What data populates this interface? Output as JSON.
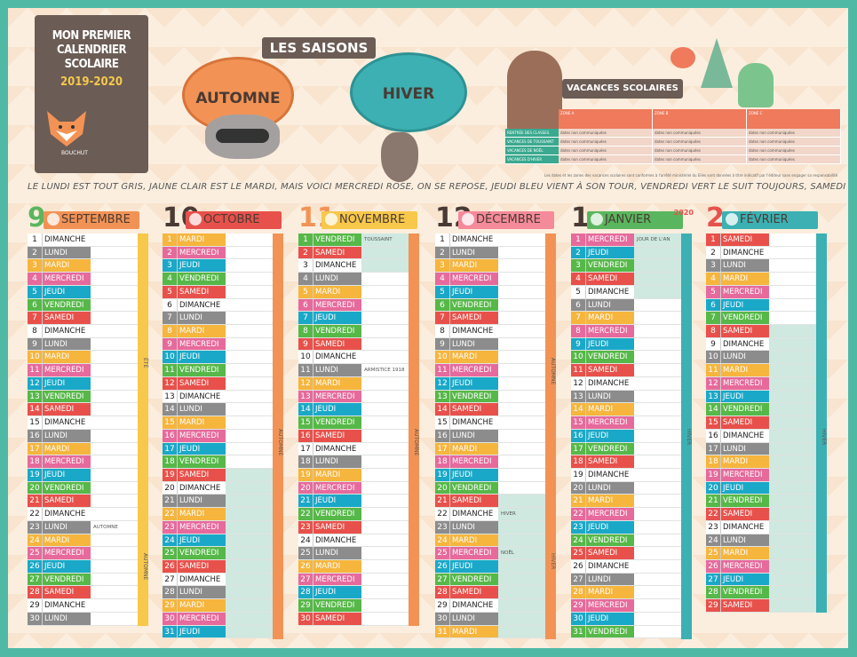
{
  "title": {
    "text": "MON PREMIER\nCALENDRIER\nSCOLAIRE",
    "year": "2019-2020",
    "brand": "BOUCHUT"
  },
  "seasons": {
    "label": "LES SAISONS",
    "autumn": "AUTOMNE",
    "winter": "HIVER"
  },
  "vacances": {
    "label": "VACANCES SCOLAIRES",
    "zones": [
      "ZONE A",
      "ZONE B",
      "ZONE C"
    ],
    "rows": [
      "RENTRÉE DES CLASSES",
      "VACANCES DE TOUSSAINT",
      "VACANCES DE NOËL",
      "VACANCES D'HIVER"
    ],
    "cell": "dates non communiquées",
    "note": "Les dates et les zones des vacances scolaires sont conformes à l'arrêté ministériel du   Elles sont données à titre indicatif par l'éditeur sans engager sa responsabilité."
  },
  "slogan": "LE LUNDI EST TOUT GRIS, JAUNE CLAIR EST LE MARDI, MAIS VOICI MERCREDI ROSE, ON SE REPOSE, JEUDI BLEU VIENT À SON TOUR, VENDREDI VERT LE SUIT TOUJOURS, SAMEDI ROUGE, DIMANCHE BLANC C'EST LA JOIE DES ENFANTS !!!",
  "day_colors": {
    "DIMANCHE": "#ffffff",
    "LUNDI": "#8c8c8c",
    "MARDI": "#f6b53d",
    "MERCREDI": "#e66a9c",
    "JEUDI": "#1aa8c8",
    "VENDREDI": "#56b848",
    "SAMEDI": "#e8514b"
  },
  "months": [
    {
      "num": "9",
      "name": "SEPTEMBRE",
      "tab": "#f29355",
      "numc": "#5ab65e",
      "start": "DIMANCHE",
      "len": 30,
      "notes": {
        "23": "AUTOMNE"
      },
      "strip": "#f7c84a",
      "strip_labels": [
        "ÉTÉ",
        "AUTOMNE"
      ]
    },
    {
      "num": "10",
      "name": "OCTOBRE",
      "tab": "#e8514b",
      "numc": "#4a3a34",
      "start": "MARDI",
      "len": 31,
      "notes": {},
      "strip": "#f29355",
      "strip_labels": [
        "AUTOMNE"
      ]
    },
    {
      "num": "11",
      "name": "NOVEMBRE",
      "tab": "#f7c84a",
      "numc": "#f29355",
      "start": "VENDREDI",
      "len": 30,
      "notes": {
        "1": "TOUSSAINT",
        "11": "ARMISTICE 1918"
      },
      "strip": "#f29355",
      "strip_labels": [
        "AUTOMNE"
      ]
    },
    {
      "num": "12",
      "name": "DÉCEMBRE",
      "tab": "#f48a9a",
      "numc": "#4a3a34",
      "start": "DIMANCHE",
      "len": 31,
      "notes": {
        "22": "HIVER",
        "25": "NOËL"
      },
      "strip": "#f29355",
      "strip_labels": [
        "AUTOMNE",
        "HIVER"
      ]
    },
    {
      "num": "1",
      "name": "JANVIER",
      "year": "2020",
      "tab": "#5ab65e",
      "numc": "#4a3a34",
      "start": "MERCREDI",
      "len": 31,
      "notes": {
        "1": "JOUR DE L'AN"
      },
      "strip": "#3cb0b2",
      "strip_labels": [
        "HIVER"
      ]
    },
    {
      "num": "2",
      "name": "FÉVRIER",
      "tab": "#3cb0b2",
      "numc": "#e8514b",
      "start": "SAMEDI",
      "len": 29,
      "notes": {},
      "strip": "#3cb0b2",
      "strip_labels": [
        "HIVER"
      ]
    }
  ],
  "weekdays": [
    "DIMANCHE",
    "LUNDI",
    "MARDI",
    "MERCREDI",
    "JEUDI",
    "VENDREDI",
    "SAMEDI"
  ],
  "holiday_days": {
    "0": [],
    "1": [
      19,
      20,
      21,
      22,
      23,
      24,
      25,
      26,
      27,
      28,
      29,
      30,
      31
    ],
    "2": [
      1,
      2,
      3
    ],
    "3": [
      21,
      22,
      23,
      24,
      25,
      26,
      27,
      28,
      29,
      30,
      31
    ],
    "4": [
      1,
      2,
      3,
      4,
      5
    ],
    "5": [
      8,
      9,
      10,
      11,
      12,
      13,
      14,
      15,
      16,
      17,
      18,
      19,
      20,
      21,
      22,
      23,
      24,
      25,
      26,
      27,
      28,
      29
    ]
  }
}
